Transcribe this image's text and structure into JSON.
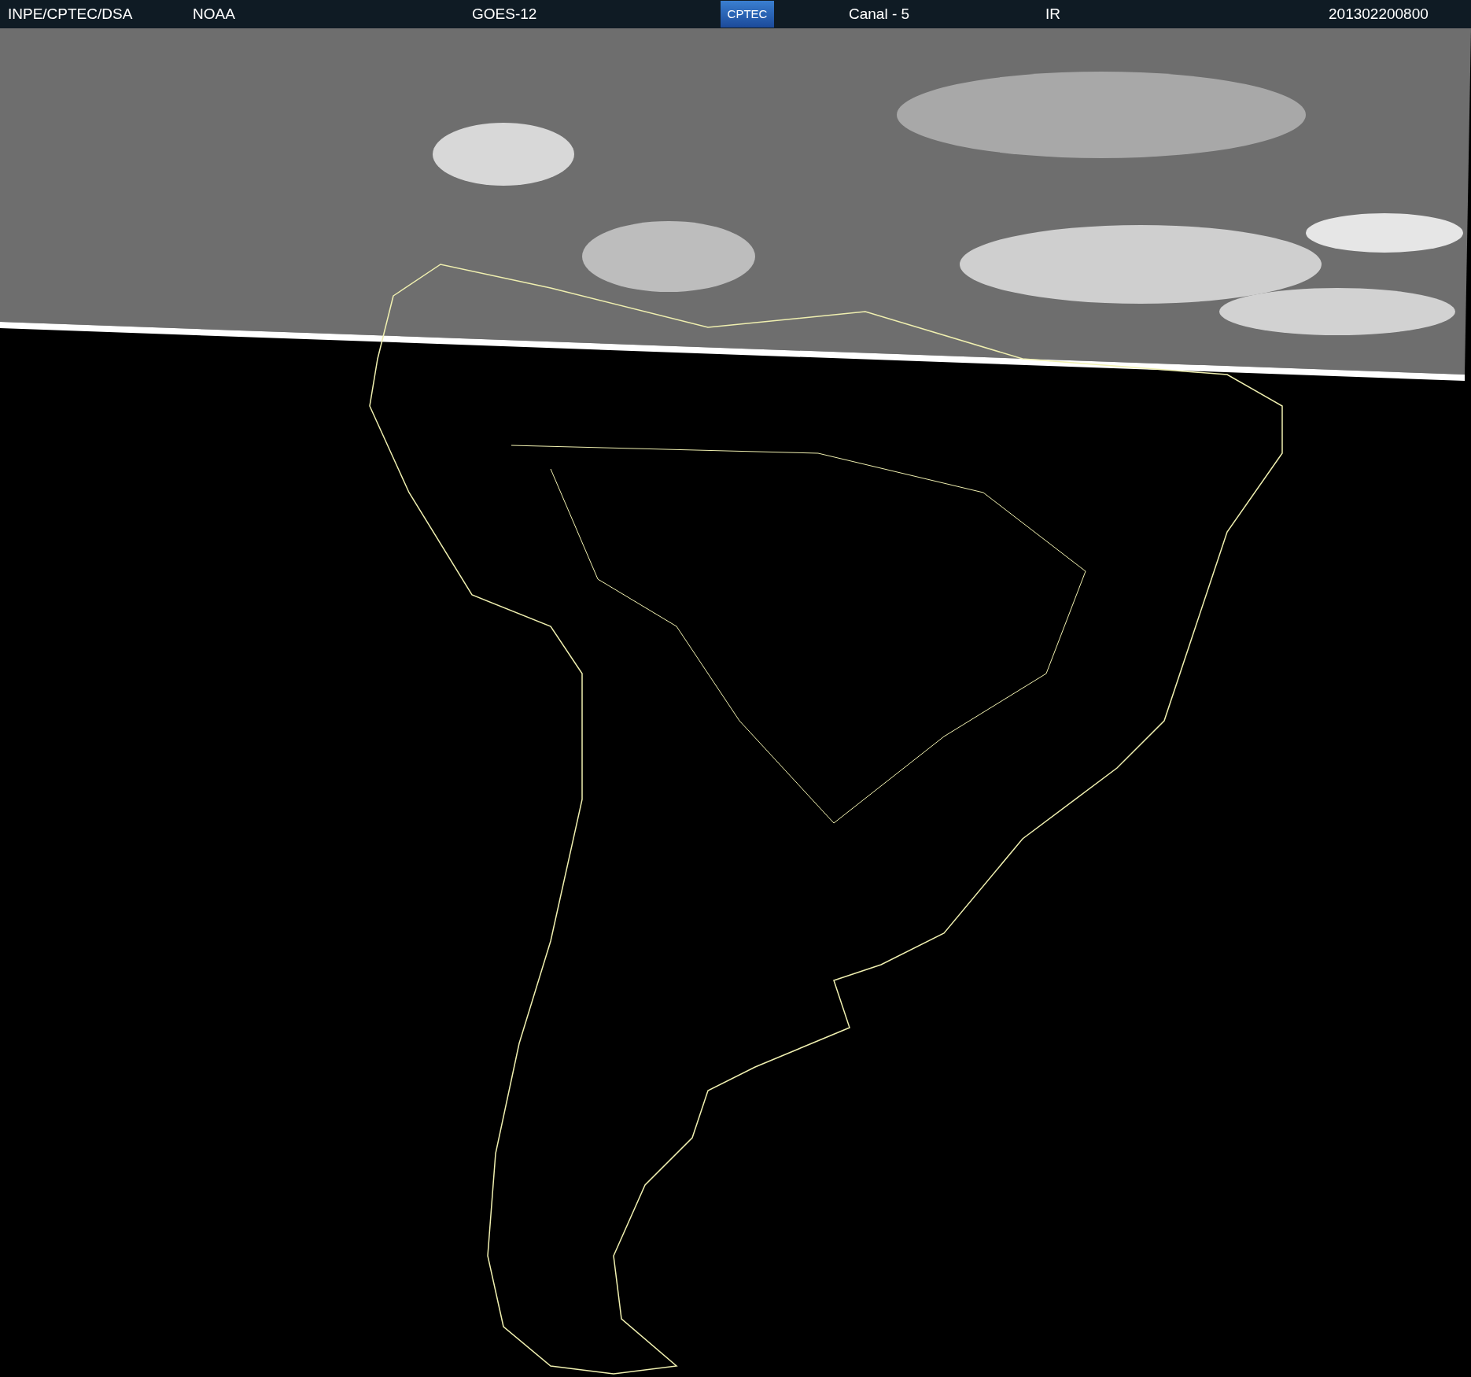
{
  "header": {
    "source": "INPE/CPTEC/DSA",
    "agency": "NOAA",
    "satellite": "GOES-12",
    "logo": "CPTEC",
    "channel": "Canal - 5",
    "band": "IR",
    "timestamp": "201302200800"
  }
}
